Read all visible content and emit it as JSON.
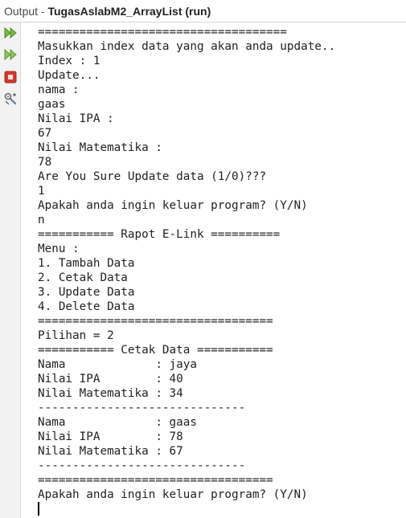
{
  "window": {
    "title_prefix": "Output - ",
    "title_project": "TugasAslabM2_ArrayList (run)"
  },
  "toolbar": {
    "buttons": [
      {
        "icon": "rerun-icon"
      },
      {
        "icon": "rerun-with-options-icon"
      },
      {
        "icon": "stop-icon"
      },
      {
        "icon": "settings-icon"
      }
    ]
  },
  "console": {
    "lines": [
      "====================================",
      "Masukkan index data yang akan anda update..",
      "Index : 1",
      "Update...",
      "nama :",
      "gaas",
      "Nilai IPA :",
      "67",
      "Nilai Matematika :",
      "78",
      "Are You Sure Update data (1/0)???",
      "1",
      "Apakah anda ingin keluar program? (Y/N)",
      "n",
      "=========== Rapot E-Link ==========",
      "Menu :",
      "1. Tambah Data",
      "2. Cetak Data",
      "3. Update Data",
      "4. Delete Data",
      "==================================",
      "Pilihan = 2",
      "=========== Cetak Data ===========",
      "Nama             : jaya",
      "Nilai IPA        : 40",
      "Nilai Matematika : 34",
      "------------------------------",
      "Nama             : gaas",
      "Nilai IPA        : 78",
      "Nilai Matematika : 67",
      "------------------------------",
      "==================================",
      "Apakah anda ingin keluar program? (Y/N)"
    ]
  },
  "colors": {
    "accent_green": "#5a9a2c",
    "stop_red": "#d03a2e",
    "text": "#222222"
  }
}
